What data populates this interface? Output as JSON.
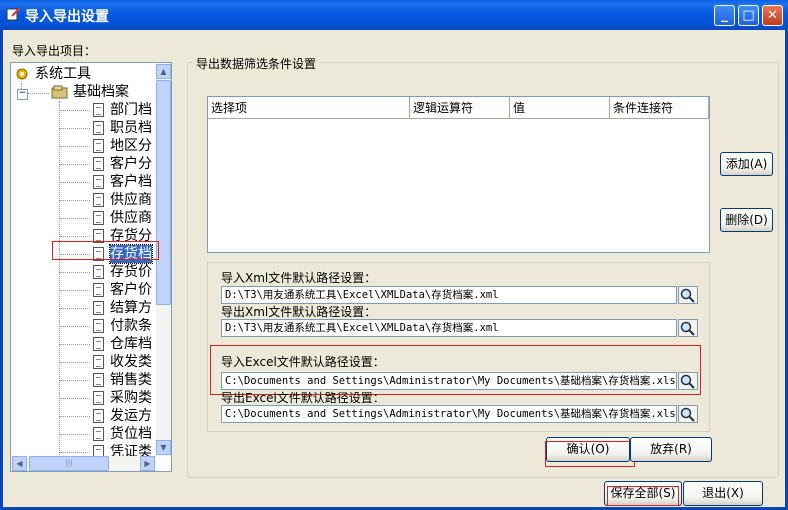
{
  "window": {
    "title": "导入导出设置"
  },
  "left": {
    "label": "导入导出项目："
  },
  "tree": {
    "root": "系统工具",
    "group": "基础档案",
    "items": [
      "部门档",
      "职员档",
      "地区分",
      "客户分",
      "客户档",
      "供应商",
      "供应商",
      "存货分",
      "存货档",
      "存货价",
      "客户价",
      "结算方",
      "付款条",
      "仓库档",
      "收发类",
      "销售类",
      "采购类",
      "发运方",
      "货位档",
      "凭证类"
    ]
  },
  "groupbox": {
    "title": "导出数据筛选条件设置"
  },
  "grid": {
    "columns": [
      "选择项",
      "逻辑运算符",
      "值",
      "条件连接符"
    ]
  },
  "buttons": {
    "add": "添加(A)",
    "delete": "删除(D)",
    "confirm": "确认(O)",
    "abandon": "放弃(R)",
    "save_all": "保存全部(S)",
    "exit": "退出(X)"
  },
  "paths": {
    "import_xml_label": "导入Xml文件默认路径设置：",
    "import_xml_value": "D:\\T3\\用友通系统工具\\Excel\\XMLData\\存货档案.xml",
    "export_xml_label": "导出Xml文件默认路径设置：",
    "export_xml_value": "D:\\T3\\用友通系统工具\\Excel\\XMLData\\存货档案.xml",
    "import_excel_label": "导入Excel文件默认路径设置：",
    "import_excel_value": "C:\\Documents and Settings\\Administrator\\My Documents\\基础档案\\存货档案.xls",
    "export_excel_label": "导出Excel文件默认路径设置：",
    "export_excel_value": "C:\\Documents and Settings\\Administrator\\My Documents\\基础档案\\存货档案.xls"
  },
  "tree_scroll": {
    "h_glyph": "|||"
  },
  "colors": {
    "titlebar": "#0558e0",
    "highlight_box": "#e02020",
    "selection": "#316ac5"
  }
}
